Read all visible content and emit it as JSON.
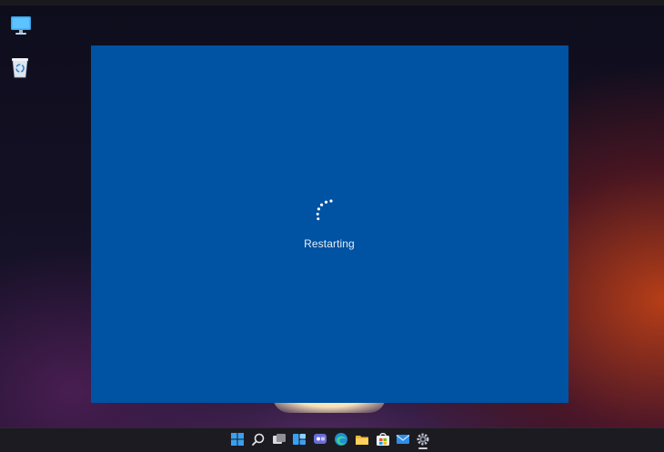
{
  "window": {
    "status_text": "Restarting",
    "background": "#0052a2"
  },
  "desktop": {
    "icons": [
      "this-pc-icon",
      "recycle-bin-icon"
    ]
  },
  "taskbar": {
    "icons": [
      "start-icon",
      "search-icon",
      "task-view-icon",
      "widgets-icon",
      "chat-icon",
      "edge-icon",
      "file-explorer-icon",
      "store-icon",
      "mail-icon",
      "settings-icon"
    ],
    "active": "settings-icon"
  },
  "colors": {
    "accent": "#0052a2",
    "taskbar": "#1c1b21"
  }
}
